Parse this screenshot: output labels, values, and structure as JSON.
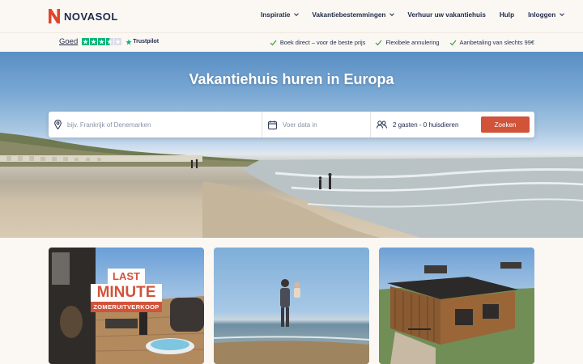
{
  "header": {
    "logo_text": "NOVASOL",
    "brand_color": "#e0452d",
    "nav": [
      {
        "label": "Inspiratie",
        "has_dropdown": true
      },
      {
        "label": "Vakantiebestemmingen",
        "has_dropdown": true
      },
      {
        "label": "Verhuur uw vakantiehuis",
        "has_dropdown": false
      },
      {
        "label": "Hulp",
        "has_dropdown": false
      },
      {
        "label": "Inloggen",
        "has_dropdown": true
      }
    ]
  },
  "trustbar": {
    "rating_label": "Goed",
    "stars": 3.5,
    "trustpilot_label": "Trustpilot",
    "usps": [
      "Boek direct – voor de beste prijs",
      "Flexibele annulering",
      "Aanbetaling van slechts 99€"
    ]
  },
  "hero": {
    "title": "Vakantiehuis huren in Europa",
    "search": {
      "destination_placeholder": "bijv. Frankrijk of Denemarken",
      "date_placeholder": "Voer data in",
      "guests_value": "2 gasten - 0 huisdieren",
      "button_label": "Zoeken",
      "button_color": "#d0533a"
    }
  },
  "cards": [
    {
      "badge_line1": "LAST",
      "badge_line2": "MINUTE",
      "badge_line3": "ZOMERUITVERKOOP",
      "badge_color": "#d0533a"
    },
    {
      "scene": "beach-family"
    },
    {
      "scene": "wooden-holiday-house"
    }
  ]
}
